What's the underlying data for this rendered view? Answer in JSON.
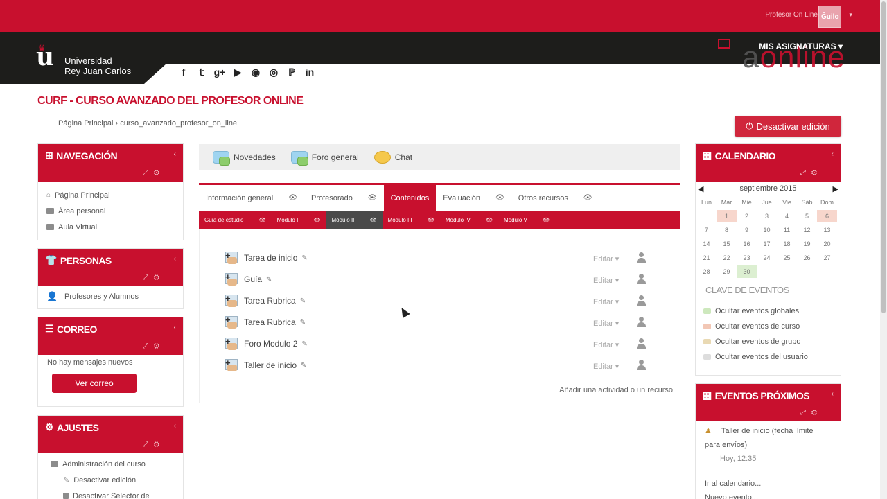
{
  "header": {
    "user_name": "Profesor On Line",
    "avatar_text": "Ĝuilo",
    "university_line1": "Universidad",
    "university_line2": "Rey Juan Carlos",
    "mis_asignaturas": "MIS ASIGNATURAS ▾",
    "online_logo_a": "a",
    "online_logo_rest": "online",
    "social_icons": [
      "facebook-icon",
      "twitter-icon",
      "google-plus-icon",
      "youtube-icon",
      "flickr-icon",
      "instagram-icon",
      "pinterest-icon",
      "linkedin-icon"
    ],
    "social_glyphs": [
      "f",
      "𝕥",
      "g+",
      "▶",
      "◉",
      "◎",
      "ℙ",
      "in"
    ]
  },
  "page": {
    "course_title": "CURF - CURSO AVANZADO DEL PROFESOR ONLINE",
    "breadcrumb": "Página Principal › curso_avanzado_profesor_on_line",
    "deactivate_button": "Desactivar edición"
  },
  "left": {
    "navegacion": {
      "title": "NAVEGACIÓN",
      "items": [
        "Página Principal",
        "Área personal",
        "Aula Virtual"
      ]
    },
    "personas": {
      "title": "PERSONAS",
      "items": [
        "Profesores y Alumnos"
      ]
    },
    "correo": {
      "title": "CORREO",
      "text": "No hay mensajes nuevos",
      "button": "Ver correo"
    },
    "ajustes": {
      "title": "AJUSTES",
      "items": [
        "Administración del curso",
        "Desactivar edición",
        "Desactivar Selector de"
      ]
    }
  },
  "center": {
    "topnav": [
      "Novedades",
      "Foro general",
      "Chat"
    ],
    "tabs": [
      "Información general",
      "Profesorado",
      "Contenidos",
      "Evaluación",
      "Otros recursos"
    ],
    "active_tab": "Contenidos",
    "subtabs": [
      "Guía de estudio",
      "Módulo I",
      "Módulo II",
      "Módulo III",
      "Módulo IV",
      "Módulo V"
    ],
    "active_subtab": "Módulo II",
    "activities": [
      "Tarea de inicio",
      "Guía",
      "Tarea Rubrica",
      "Tarea Rubrica",
      "Foro Modulo 2",
      "Taller de inicio"
    ],
    "edit_label": "Editar ▾",
    "add_activity": "Añadir una actividad o un recurso"
  },
  "right": {
    "calendario": {
      "title": "CALENDARIO",
      "month": "septiembre 2015",
      "weekdays": [
        "Lun",
        "Mar",
        "Mié",
        "Jue",
        "Vie",
        "Sáb",
        "Dom"
      ],
      "days": [
        "",
        "1",
        "2",
        "3",
        "4",
        "5",
        "6",
        "7",
        "8",
        "9",
        "10",
        "11",
        "12",
        "13",
        "14",
        "15",
        "16",
        "17",
        "18",
        "19",
        "20",
        "21",
        "22",
        "23",
        "24",
        "25",
        "26",
        "27",
        "28",
        "29",
        "30",
        "",
        "",
        "",
        ""
      ],
      "highlight_days": [
        "1",
        "6"
      ],
      "today": "30",
      "clave": "CLAVE DE EVENTOS",
      "events_key": [
        {
          "label": "Ocultar eventos globales",
          "color": "#cde8bd"
        },
        {
          "label": "Ocultar eventos de curso",
          "color": "#f2c7b5"
        },
        {
          "label": "Ocultar eventos de grupo",
          "color": "#e9d9b3"
        },
        {
          "label": "Ocultar eventos del usuario",
          "color": "#dddddd"
        }
      ]
    },
    "eventos": {
      "title": "EVENTOS PRÓXIMOS",
      "event_name": "Taller de inicio (fecha límite",
      "event_name2": "para envíos)",
      "event_time": "Hoy, 12:35",
      "link1": "Ir al calendario...",
      "link2": "Nuevo evento..."
    }
  }
}
